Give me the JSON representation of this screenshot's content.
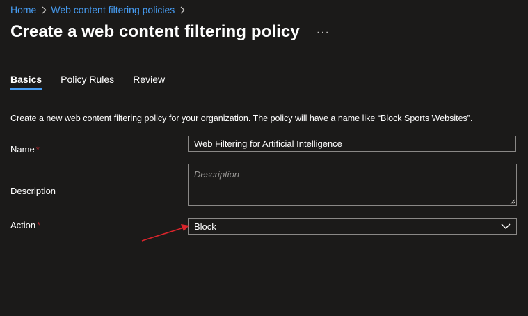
{
  "breadcrumb": {
    "items": [
      {
        "label": "Home"
      },
      {
        "label": "Web content filtering policies"
      }
    ],
    "separator": "›"
  },
  "header": {
    "title": "Create a web content filtering policy",
    "more_label": "···"
  },
  "tabs": [
    {
      "label": "Basics",
      "active": true
    },
    {
      "label": "Policy Rules",
      "active": false
    },
    {
      "label": "Review",
      "active": false
    }
  ],
  "form": {
    "intro": "Create a new web content filtering policy for your organization. The policy will have a name like “Block Sports Websites”.",
    "name": {
      "label": "Name",
      "required_mark": "*",
      "value": "Web Filtering for Artificial Intelligence"
    },
    "description": {
      "label": "Description",
      "placeholder": "Description",
      "value": ""
    },
    "action": {
      "label": "Action",
      "required_mark": "*",
      "selected": "Block"
    }
  },
  "colors": {
    "background": "#1b1a19",
    "link": "#479ef5",
    "required": "#a4262c",
    "annotation_arrow": "#d9242b",
    "border": "#8a8886"
  },
  "icons": {
    "breadcrumb_separator": "chevron-right-icon",
    "more": "more-icon",
    "dropdown": "chevron-down-icon",
    "annotation": "red-arrow-icon"
  }
}
